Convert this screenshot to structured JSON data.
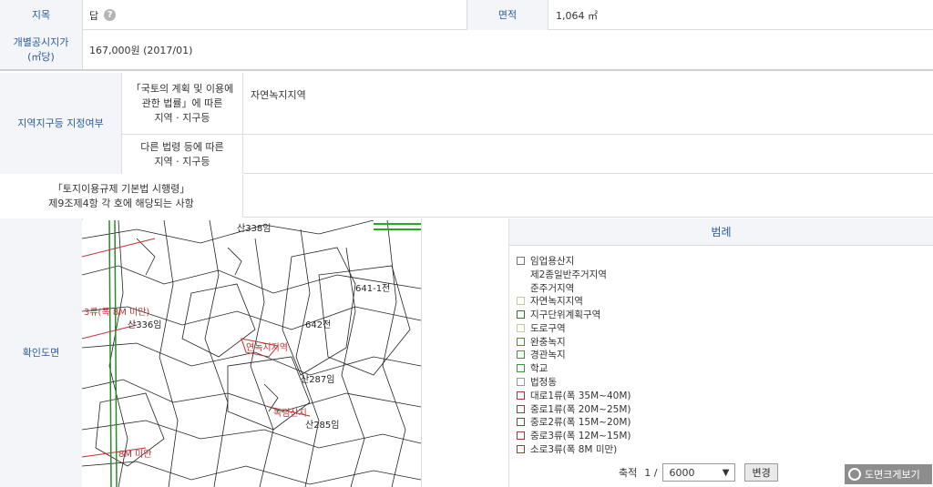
{
  "rows": {
    "jimok_label": "지목",
    "jimok_value": "답",
    "area_label": "면적",
    "area_value": "1,064 ㎡",
    "price_label": "개별공시지가\n(㎡당)",
    "price_value": "167,000원 (2017/01)",
    "zone_label": "지역지구등 지정여부",
    "zone_sub1_label": "「국토의 계획 및 이용에\n관한 법률」에 따른\n지역 · 지구등",
    "zone_sub1_value": "자연녹지지역",
    "zone_sub2_label": "다른 법령 등에 따른\n지역 · 지구등",
    "zone_sub2_value": "",
    "rule_label": "「토지이용규제 기본법 시행령」\n제9조제4항 각 호에 해당되는 사항",
    "rule_value": "",
    "map_label": "확인도면"
  },
  "map": {
    "labels": [
      {
        "text": "산338임"
      },
      {
        "text": "641-1전"
      },
      {
        "text": "642전"
      },
      {
        "text": "산336임"
      },
      {
        "text": "산287임"
      },
      {
        "text": "산285임"
      },
      {
        "text": "3류(폭 8M 미만)"
      },
      {
        "text": "8M 미만"
      },
      {
        "text": "연녹지지역"
      },
      {
        "text": "녹림산지"
      }
    ]
  },
  "legend": {
    "title": "범례",
    "items": [
      {
        "label": "임업용산지",
        "color": "#ffffff",
        "border": "#777777"
      },
      {
        "label": "제2종일반주거지역",
        "color": "",
        "border": ""
      },
      {
        "label": "준주거지역",
        "color": "",
        "border": ""
      },
      {
        "label": "자연녹지지역",
        "color": "#ffffff",
        "border": "#c8c8a0"
      },
      {
        "label": "지구단위계획구역",
        "color": "#ffffff",
        "border": "#2c7a2c"
      },
      {
        "label": "도로구역",
        "color": "#ffffff",
        "border": "#c8c8a0"
      },
      {
        "label": "완충녹지",
        "color": "#ffffff",
        "border": "#3a9a3a"
      },
      {
        "label": "경관녹지",
        "color": "#ffffff",
        "border": "#3a9a3a"
      },
      {
        "label": "학교",
        "color": "#ffffff",
        "border": "#3a9a3a"
      },
      {
        "label": "법정동",
        "color": "#ffffff",
        "border": "#999999"
      },
      {
        "label": "대로1류(폭 35M~40M)",
        "color": "#ffffff",
        "border": "#9a3a3a"
      },
      {
        "label": "중로1류(폭 20M~25M)",
        "color": "#ffffff",
        "border": "#9a3a3a"
      },
      {
        "label": "중로2류(폭 15M~20M)",
        "color": "#ffffff",
        "border": "#9a3a3a"
      },
      {
        "label": "중로3류(폭 12M~15M)",
        "color": "#ffffff",
        "border": "#9a3a3a"
      },
      {
        "label": "소로3류(폭 8M 미만)",
        "color": "#ffffff",
        "border": "#9a3a3a"
      }
    ],
    "scale_label": "축적",
    "scale_prefix": "1 /",
    "scale_value": "6000",
    "change_button": "변경",
    "enlarge_button": "도면크게보기"
  }
}
